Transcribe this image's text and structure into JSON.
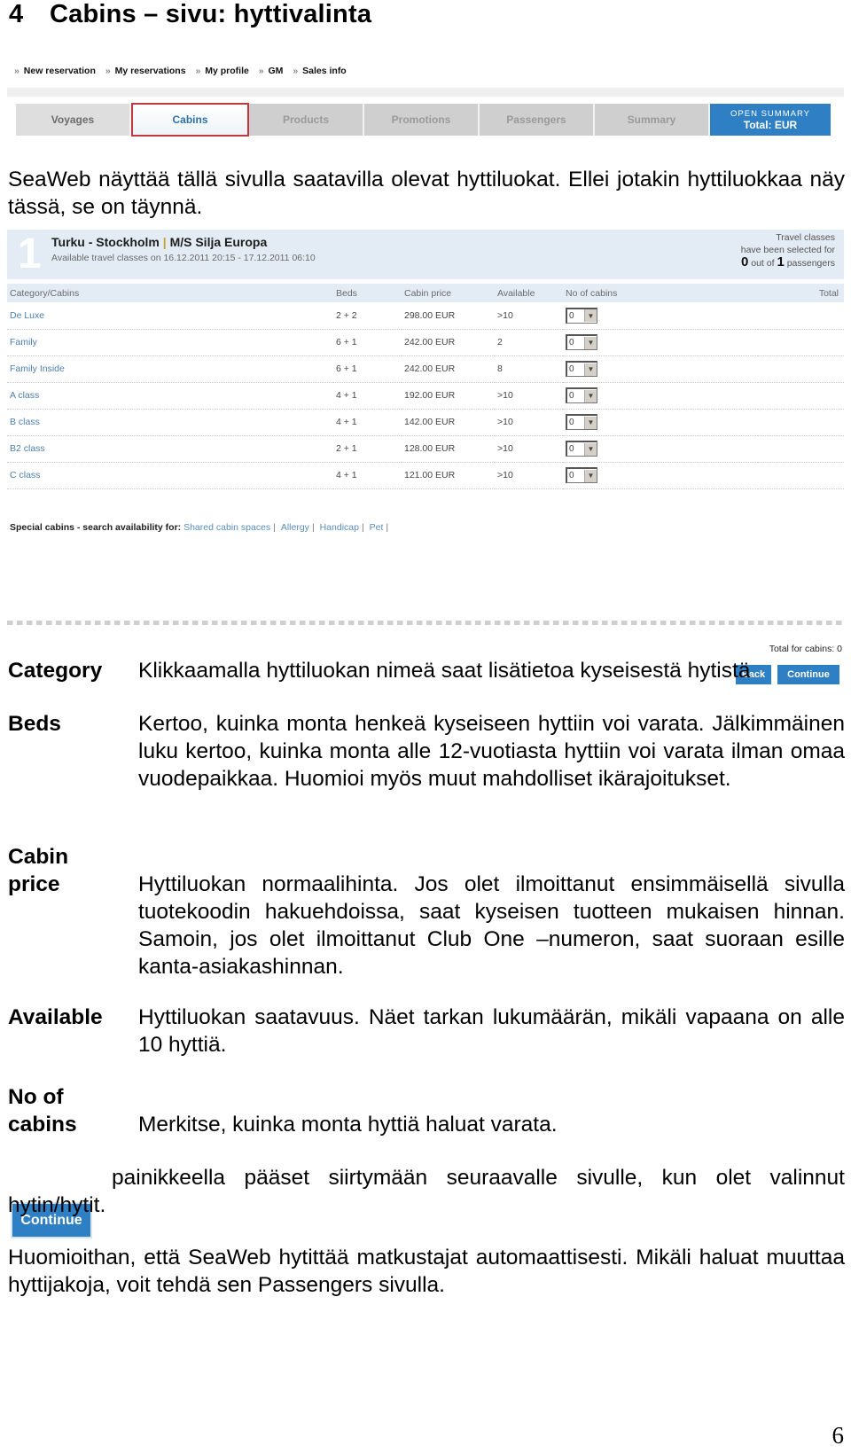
{
  "doc": {
    "section_number": "4",
    "title": "Cabins – sivu: hyttivalinta",
    "intro": "SeaWeb näyttää tällä sivulla saatavilla olevat hyttiluokat. Ellei jotakin hyttiluokkaa näy tässä, se on täynnä.",
    "page_number": "6"
  },
  "screenshot": {
    "topnav": [
      "New reservation",
      "My reservations",
      "My profile",
      "GM",
      "Sales info"
    ],
    "steps": [
      "Voyages",
      "Cabins",
      "Products",
      "Promotions",
      "Passengers",
      "Summary"
    ],
    "active_step": "Cabins",
    "summary_button": {
      "line1": "OPEN SUMMARY",
      "line2": "Total: EUR"
    },
    "voyage": {
      "number": "1",
      "route": "Turku - Stockholm",
      "separator": "|",
      "ship": "M/S Silja Europa",
      "subtitle": "Available travel classes on 16.12.2011 20:15 - 17.12.2011 06:10",
      "status_line1": "Travel classes",
      "status_line2": "have been selected for",
      "selected": "0",
      "out_of": "out of",
      "total_passengers": "1",
      "passengers_label": "passengers"
    },
    "table": {
      "headers": [
        "Category/Cabins",
        "Beds",
        "Cabin price",
        "Available",
        "No of cabins",
        "Total"
      ],
      "rows": [
        {
          "category": "De Luxe",
          "beds": "2 + 2",
          "price": "298.00 EUR",
          "available": ">10",
          "count": "0"
        },
        {
          "category": "Family",
          "beds": "6 + 1",
          "price": "242.00 EUR",
          "available": "2",
          "count": "0"
        },
        {
          "category": "Family Inside",
          "beds": "6 + 1",
          "price": "242.00 EUR",
          "available": "8",
          "count": "0"
        },
        {
          "category": "A class",
          "beds": "4 + 1",
          "price": "192.00 EUR",
          "available": ">10",
          "count": "0"
        },
        {
          "category": "B class",
          "beds": "4 + 1",
          "price": "142.00 EUR",
          "available": ">10",
          "count": "0"
        },
        {
          "category": "B2 class",
          "beds": "2 + 1",
          "price": "128.00 EUR",
          "available": ">10",
          "count": "0"
        },
        {
          "category": "C class",
          "beds": "4 + 1",
          "price": "121.00 EUR",
          "available": ">10",
          "count": "0"
        }
      ]
    },
    "special": {
      "label": "Special cabins - search availability for:",
      "links": [
        "Shared cabin spaces",
        "Allergy",
        "Handicap",
        "Pet"
      ]
    },
    "total_for_cabins": "Total for cabins: 0",
    "back_label": "Back",
    "continue_label": "Continue"
  },
  "definitions": [
    {
      "term": "Category",
      "desc": "Klikkaamalla hyttiluokan nimeä saat lisätietoa kyseisestä hytistä"
    },
    {
      "term": "Beds",
      "desc": "Kertoo, kuinka monta henkeä kyseiseen hyttiin voi varata. Jälkimmäinen luku kertoo, kuinka monta alle 12-vuotiasta hyttiin voi varata ilman omaa vuodepaikkaa. Huomioi myös muut mahdolliset ikärajoitukset."
    },
    {
      "term": "Cabin price",
      "desc": "Hyttiluokan normaalihinta. Jos olet ilmoittanut ensimmäisellä sivulla tuotekoodin hakuehdoissa, saat kyseisen tuotteen mukaisen hinnan. Samoin, jos olet ilmoittanut Club One –numeron, saat suoraan esille kanta-asiakashinnan."
    },
    {
      "term": "Available",
      "desc": "Hyttiluokan saatavuus. Näet tarkan lukumäärän, mikäli vapaana on alle 10 hyttiä."
    },
    {
      "term": "No of cabins",
      "desc": "Merkitse, kuinka monta hyttiä haluat varata."
    }
  ],
  "continue_note": {
    "button_label": "Continue",
    "text": "painikkeella pääset siirtymään seuraavalle sivulle, kun olet valinnut hytin/hytit."
  },
  "final_note": "Huomioithan, että SeaWeb hytittää matkustajat automaattisesti. Mikäli haluat muuttaa hyttijakoja, voit tehdä sen Passengers sivulla."
}
